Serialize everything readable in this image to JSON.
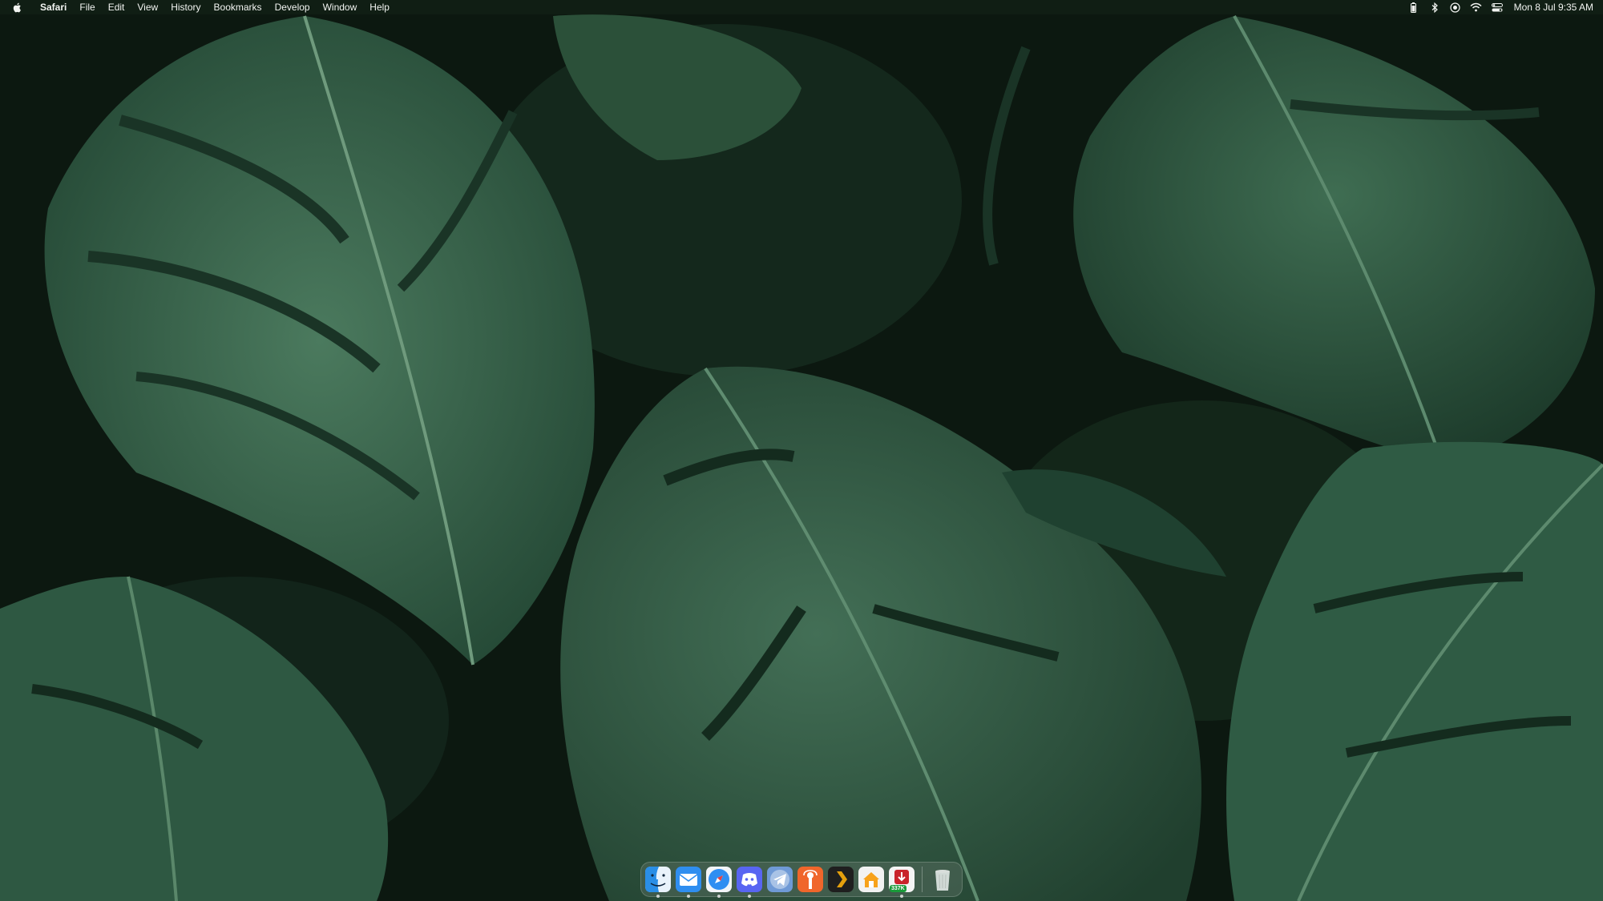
{
  "menubar": {
    "app_name": "Safari",
    "menus": [
      "File",
      "Edit",
      "View",
      "History",
      "Bookmarks",
      "Develop",
      "Window",
      "Help"
    ],
    "status_icons": [
      "battery-icon",
      "bluetooth-icon",
      "screen-record-icon",
      "wifi-icon",
      "control-center-icon"
    ],
    "clock": "Mon 8 Jul  9:35 AM"
  },
  "dock": {
    "apps": [
      {
        "name": "Finder",
        "icon": "finder-icon",
        "running": true
      },
      {
        "name": "Mail",
        "icon": "mail-icon",
        "running": true
      },
      {
        "name": "Safari",
        "icon": "safari-icon",
        "running": true
      },
      {
        "name": "Discord",
        "icon": "discord-icon",
        "running": true
      },
      {
        "name": "Telegram",
        "icon": "telegram-icon",
        "running": false
      },
      {
        "name": "Castro",
        "icon": "castro-icon",
        "running": false
      },
      {
        "name": "Plex",
        "icon": "plex-icon",
        "running": false
      },
      {
        "name": "Home",
        "icon": "home-icon",
        "running": false
      },
      {
        "name": "Downloader",
        "icon": "downloader-icon",
        "running": true,
        "badge": "337K"
      }
    ],
    "trash": {
      "name": "Trash",
      "icon": "trash-icon"
    }
  },
  "colors": {
    "wallpaper_base": "#0d1a12",
    "leaf": "#2f5a43",
    "leaf_light": "#4b7a5e",
    "menubar_bg": "#122016"
  }
}
